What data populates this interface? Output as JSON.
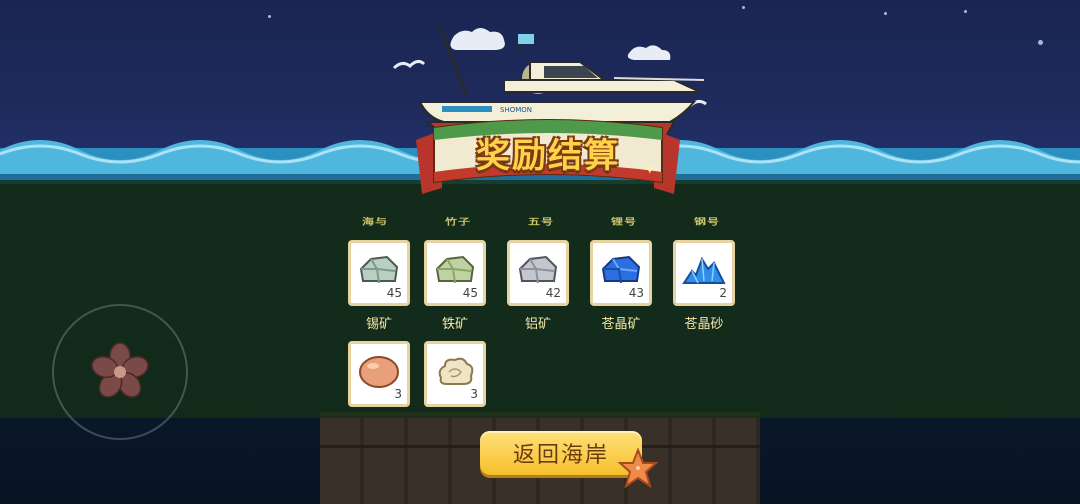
{
  "title": "奖励结算",
  "boat": {
    "name_plate": "SHOMON"
  },
  "column_labels": [
    "海与",
    "竹子",
    "五号",
    "锂号",
    "钢号"
  ],
  "items": [
    {
      "name": "锡矿",
      "count": "45",
      "icon": "tin-ore-icon",
      "color": "#9fb8a8"
    },
    {
      "name": "铁矿",
      "count": "45",
      "icon": "iron-ore-icon",
      "color": "#a9bf8f"
    },
    {
      "name": "铝矿",
      "count": "42",
      "icon": "aluminum-ore-icon",
      "color": "#9aa0a8"
    },
    {
      "name": "苍晶矿",
      "count": "43",
      "icon": "azure-crystal-ore-icon",
      "color": "#1f5fd0"
    },
    {
      "name": "苍晶砂",
      "count": "2",
      "icon": "azure-crystal-sand-icon",
      "color": "#2e8ee8"
    },
    {
      "name": "",
      "count": "3",
      "icon": "egg-icon",
      "color": "#e9a07a"
    },
    {
      "name": "",
      "count": "3",
      "icon": "fluff-icon",
      "color": "#e8dcb8"
    }
  ],
  "buttons": {
    "return_label": "返回海岸"
  },
  "colors": {
    "title_fill": "#ffd24a",
    "button": "#f6bf2d",
    "overlay": "#143014"
  }
}
